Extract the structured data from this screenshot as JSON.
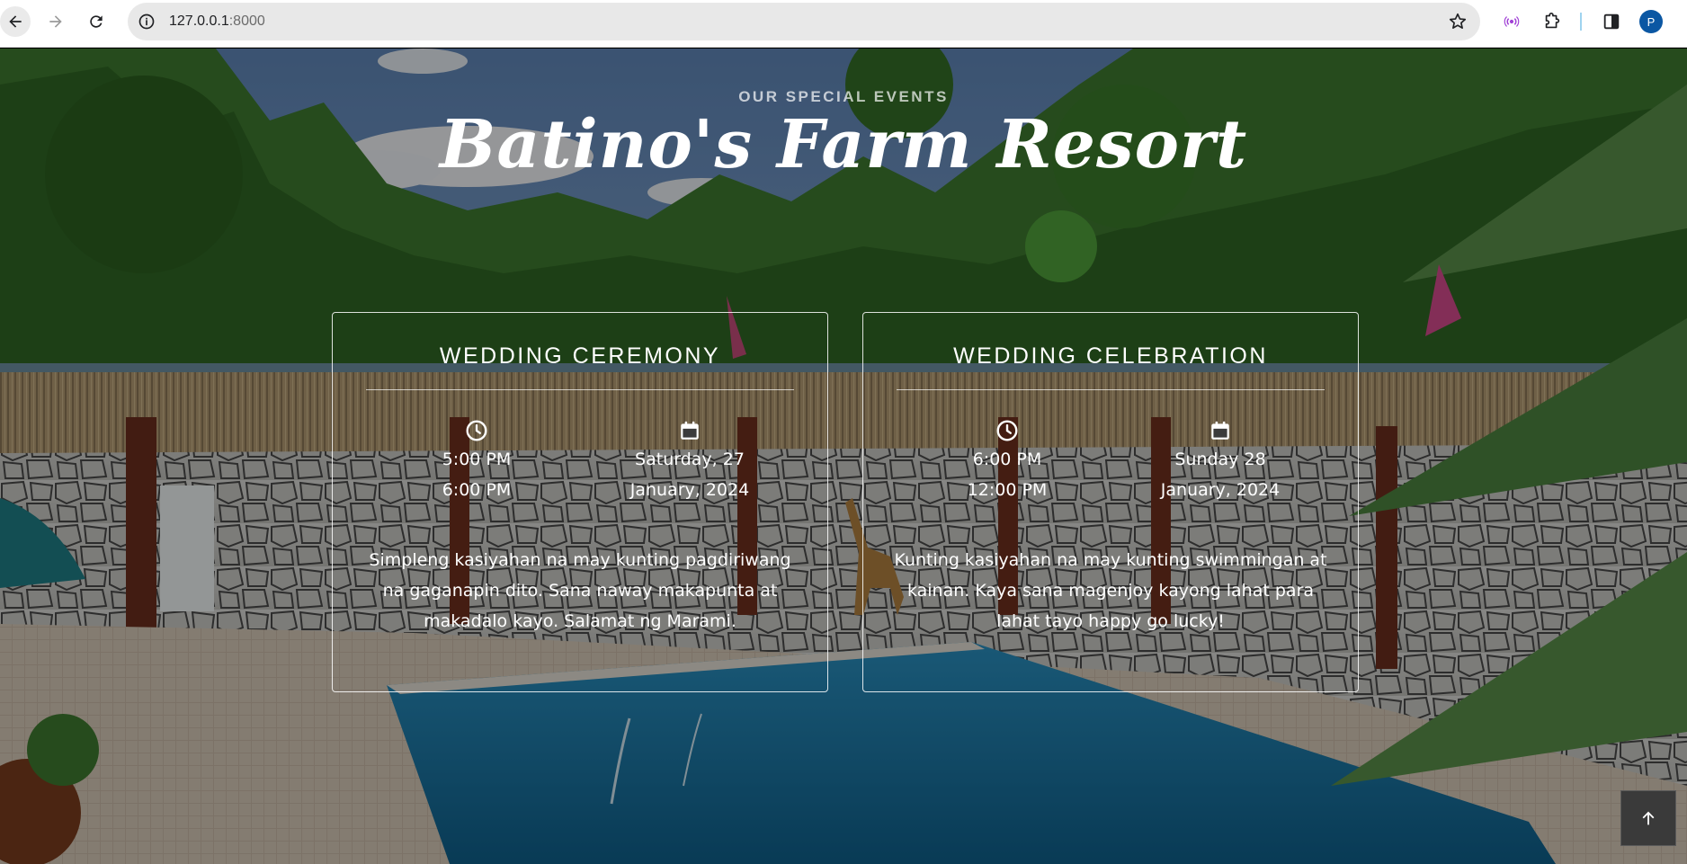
{
  "browser": {
    "url_host": "127.0.0.1",
    "url_port": ":8000",
    "profile_initial": "P",
    "icons": [
      "back-icon",
      "forward-icon",
      "reload-icon",
      "site-info-icon",
      "bookmark-star-icon",
      "cast-icon",
      "extensions-icon",
      "side-panel-icon"
    ]
  },
  "hero": {
    "eyebrow": "OUR SPECIAL EVENTS",
    "title": "Batino's Farm Resort"
  },
  "events": [
    {
      "title": "WEDDING CEREMONY",
      "time_start": "5:00 PM",
      "time_end": "6:00 PM",
      "date_line1": "Saturday, 27",
      "date_line2": "January, 2024",
      "description": "Simpleng kasiyahan na may kunting pagdiriwang na gaganapin dito. Sana naway makapunta at makadalo kayo. Salamat ng Marami."
    },
    {
      "title": "WEDDING CELEBRATION",
      "time_start": "6:00 PM",
      "time_end": "12:00 PM",
      "date_line1": "Sunday 28",
      "date_line2": "January, 2024",
      "description": "Kunting kasiyahan na may kunting swimmingan at kainan. Kaya sana magenjoy kayong lahat para lahat tayo happy go lucky!"
    }
  ],
  "colors": {
    "accent_profile": "#0b57a3",
    "card_border": "#ffffff",
    "pool": "#1f7fae"
  }
}
